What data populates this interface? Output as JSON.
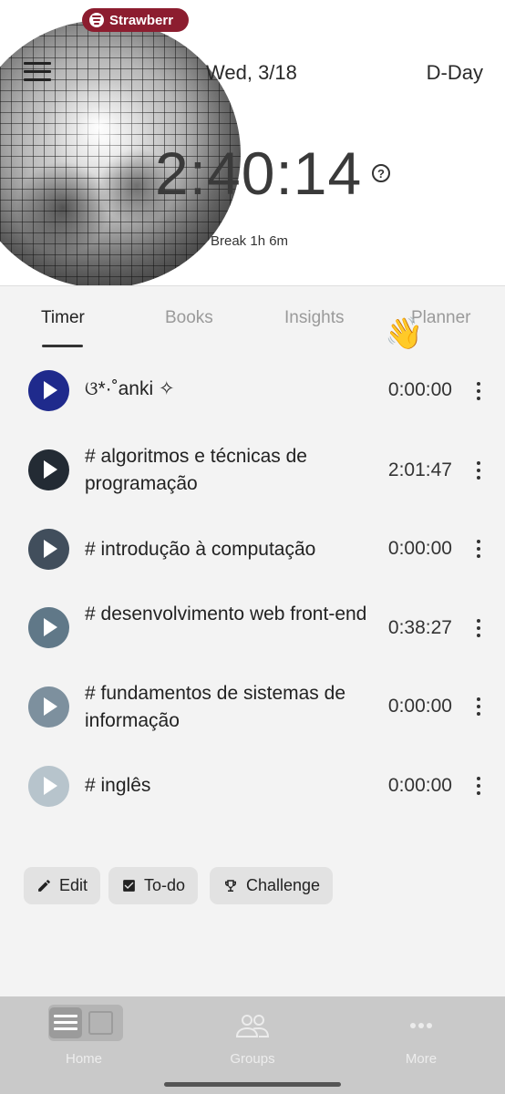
{
  "now_playing": {
    "label": "Strawberr",
    "icon": "spotify-icon",
    "color": "#8c1d2f"
  },
  "header": {
    "date": "Wed, 3/18",
    "dday": "D-Day",
    "total_time": "2:40:14",
    "help_glyph": "?",
    "break_text": "Break 1h 6m"
  },
  "tabs": [
    {
      "label": "Timer",
      "active": true
    },
    {
      "label": "Books",
      "active": false
    },
    {
      "label": "Insights",
      "active": false
    },
    {
      "label": "Planner",
      "active": false
    }
  ],
  "planner_emoji": "👋",
  "subjects": [
    {
      "name": "ଓ*·˚anki ✧",
      "time": "0:00:00",
      "color": "#1f2a8c"
    },
    {
      "name": "# algoritmos e técnicas de programação",
      "time": "2:01:47",
      "color": "#232b34"
    },
    {
      "name": "# introdução à computação",
      "time": "0:00:00",
      "color": "#414e5c"
    },
    {
      "name": "# desenvolvimento web front-end",
      "time": "0:38:27",
      "color": "#607888"
    },
    {
      "name": "# fundamentos de sistemas de informação",
      "time": "0:00:00",
      "color": "#7d909e"
    },
    {
      "name": "# inglês",
      "time": "0:00:00",
      "color": "#b7c4cc"
    }
  ],
  "actions": {
    "edit": "Edit",
    "todo": "To-do",
    "challenge": "Challenge"
  },
  "nav": {
    "home": "Home",
    "groups": "Groups",
    "more": "More"
  }
}
